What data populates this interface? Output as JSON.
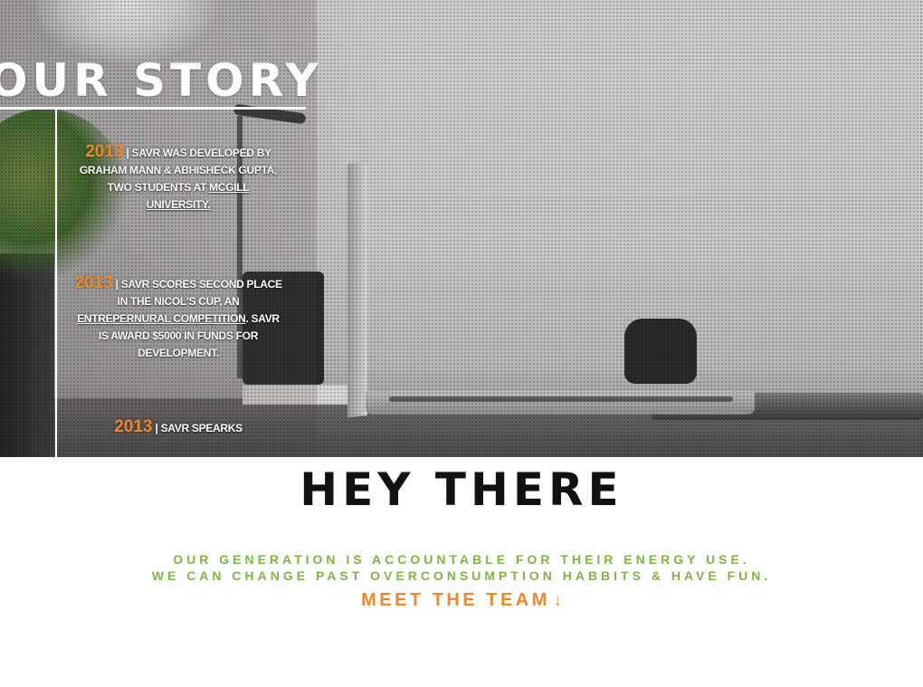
{
  "hero": {
    "title": "OUR STORY",
    "timeline": [
      {
        "year": "2013",
        "text_before": " | SAVR WAS DEVELOPED BY GRAHAM MANN & ABHISHECK GUPTA, TWO STUDENTS AT ",
        "link": "MCGILL UNIVERSITY.",
        "text_after": ""
      },
      {
        "year": "2013",
        "text_before": " | SAVR SCORES SECOND PLACE IN THE NICOL'S CUP, AN ",
        "link": "ENTREPERNURAL COMPETITION",
        "text_after": ". SAVR IS AWARD $5000 IN FUNDS FOR DEVELOPMENT."
      },
      {
        "year": "2013",
        "text_before": " | SAVR SPEARKS",
        "link": "",
        "text_after": ""
      }
    ]
  },
  "intro": {
    "heading": "HEY THERE",
    "tagline_1": "OUR GENERATION IS ACCOUNTABLE FOR THEIR ENERGY USE.",
    "tagline_2": "WE CAN CHANGE PAST OVERCONSUMPTION HABBITS & HAVE FUN.",
    "cta_label": "MEET THE TEAM",
    "cta_icon": "arrow-down-icon"
  },
  "colors": {
    "accent_orange": "#f0872a",
    "accent_green": "#7bb843",
    "heading_dark": "#111111"
  }
}
